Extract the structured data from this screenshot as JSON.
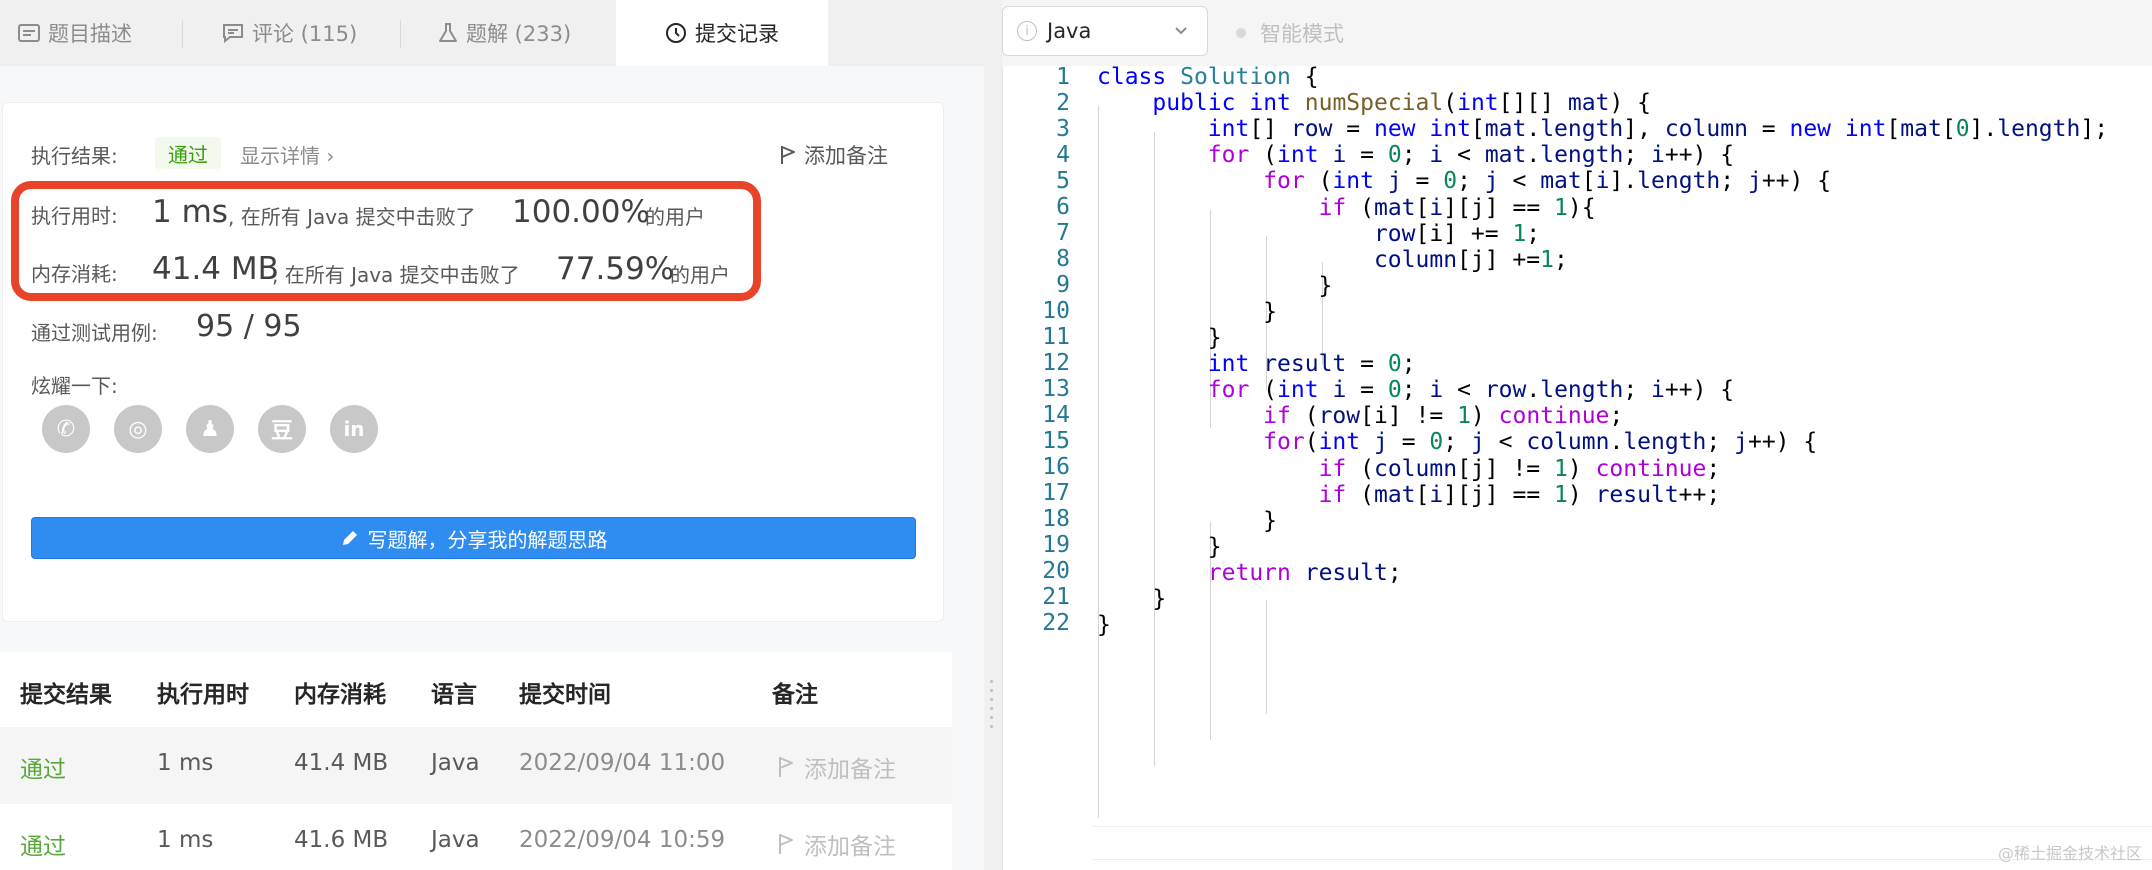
{
  "tabs": [
    {
      "label": "题目描述",
      "icon": "description-icon"
    },
    {
      "label": "评论 (115)",
      "icon": "comment-icon"
    },
    {
      "label": "题解 (233)",
      "icon": "flask-icon"
    },
    {
      "label": "提交记录",
      "icon": "clock-icon"
    }
  ],
  "result": {
    "label": "执行结果:",
    "status": "通过",
    "detail_link": "显示详情 ›",
    "add_note": "添加备注",
    "runtime_label": "执行用时:",
    "runtime_value": "1 ms",
    "runtime_text": ", 在所有 Java 提交中击败了",
    "runtime_percent": "100.00%",
    "runtime_suffix": "的用户",
    "memory_label": "内存消耗:",
    "memory_value": "41.4 MB",
    "memory_text": ", 在所有 Java 提交中击败了",
    "memory_percent": "77.59%",
    "memory_suffix": "的用户",
    "testcases_label": "通过测试用例:",
    "testcases_value": "95 / 95",
    "share_label": "炫耀一下:",
    "share_icons": [
      "wechat-icon",
      "weibo-icon",
      "qq-icon",
      "douban-icon",
      "linkedin-icon"
    ],
    "share_glyphs": [
      "✆",
      "◎",
      "♟",
      "豆",
      "in"
    ],
    "write_button": "写题解，分享我的解题思路"
  },
  "table": {
    "headers": [
      "提交结果",
      "执行用时",
      "内存消耗",
      "语言",
      "提交时间",
      "备注"
    ],
    "rows": [
      {
        "status": "通过",
        "time": "1 ms",
        "memory": "41.4 MB",
        "lang": "Java",
        "submitted": "2022/09/04 11:00",
        "note": "添加备注"
      },
      {
        "status": "通过",
        "time": "1 ms",
        "memory": "41.6 MB",
        "lang": "Java",
        "submitted": "2022/09/04 10:59",
        "note": "添加备注"
      }
    ]
  },
  "editor": {
    "language": "Java",
    "info_glyph": "i",
    "smart_mode": "智能模式",
    "line_numbers": [
      "1",
      "2",
      "3",
      "4",
      "5",
      "6",
      "7",
      "8",
      "9",
      "10",
      "11",
      "12",
      "13",
      "14",
      "15",
      "16",
      "17",
      "18",
      "19",
      "20",
      "21",
      "22"
    ]
  },
  "watermark": "@稀土掘金技术社区"
}
